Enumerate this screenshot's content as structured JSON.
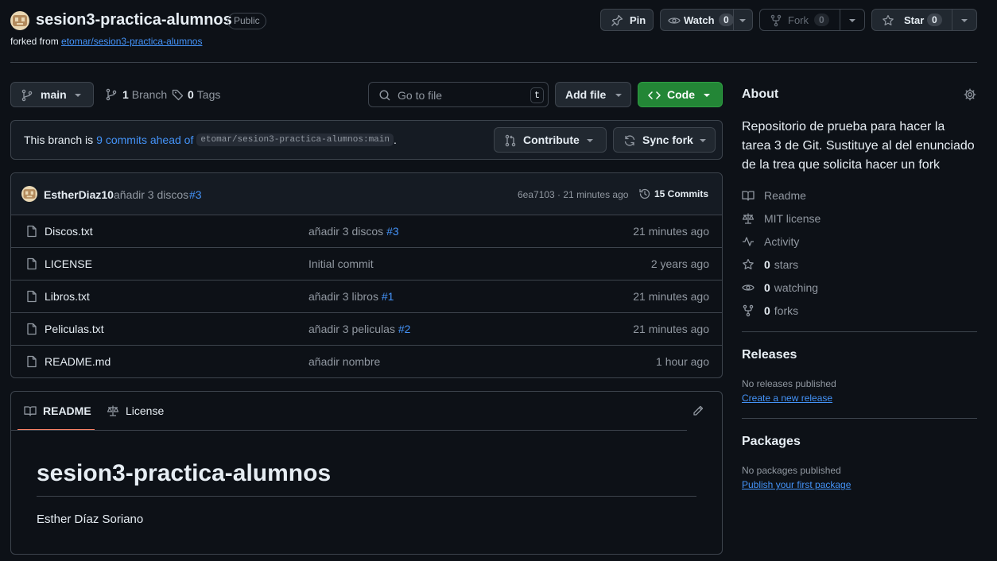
{
  "repo": {
    "name": "sesion3-practica-alumnos",
    "visibility": "Public",
    "forked_prefix": "forked from",
    "forked_from": "etomar/sesion3-practica-alumnos"
  },
  "actions": {
    "pin": "Pin",
    "watch": "Watch",
    "watch_count": "0",
    "fork": "Fork",
    "fork_count": "0",
    "star": "Star",
    "star_count": "0"
  },
  "toolbar": {
    "branch": "main",
    "branches_count": "1",
    "branches_label": "Branch",
    "tags_count": "0",
    "tags_label": "Tags",
    "search_placeholder": "Go to file",
    "search_shortcut": "t",
    "add_file": "Add file",
    "code": "Code"
  },
  "fork_status": {
    "prefix": "This branch is",
    "ahead": "9 commits ahead of",
    "upstream": "etomar/sesion3-practica-alumnos:main",
    "suffix": ".",
    "contribute": "Contribute",
    "sync": "Sync fork"
  },
  "latest_commit": {
    "author": "EstherDiaz10",
    "message": "añadir 3 discos",
    "pr": "#3",
    "meta": "6ea7103 · 21 minutes ago",
    "commits_label": "15 Commits"
  },
  "files": [
    {
      "name": "Discos.txt",
      "message": "añadir 3 discos",
      "pr": "#3",
      "date": "21 minutes ago"
    },
    {
      "name": "LICENSE",
      "message": "Initial commit",
      "pr": "",
      "date": "2 years ago"
    },
    {
      "name": "Libros.txt",
      "message": "añadir 3 libros",
      "pr": "#1",
      "date": "21 minutes ago"
    },
    {
      "name": "Peliculas.txt",
      "message": "añadir 3 peliculas",
      "pr": "#2",
      "date": "21 minutes ago"
    },
    {
      "name": "README.md",
      "message": "añadir nombre",
      "pr": "",
      "date": "1 hour ago"
    }
  ],
  "readme": {
    "tab_readme": "README",
    "tab_license": "License",
    "heading": "sesion3-practica-alumnos",
    "body": "Esther Díaz Soriano"
  },
  "about": {
    "title": "About",
    "description": "Repositorio de prueba para hacer la tarea 3 de Git. Sustituye al del enunciado de la trea que solicita hacer un fork",
    "readme": "Readme",
    "license": "MIT license",
    "activity": "Activity",
    "stars_count": "0",
    "stars_label": "stars",
    "watching_count": "0",
    "watching_label": "watching",
    "forks_count": "0",
    "forks_label": "forks"
  },
  "releases": {
    "title": "Releases",
    "empty": "No releases published",
    "create_link": "Create a new release"
  },
  "packages": {
    "title": "Packages",
    "empty": "No packages published",
    "publish_link": "Publish your first package"
  },
  "colors": {
    "background": "#0d1117",
    "border": "#3d444d",
    "link": "#4493f8",
    "code_button": "#238636",
    "muted": "#9198a1",
    "readme_tab_underline": "#f78166"
  }
}
